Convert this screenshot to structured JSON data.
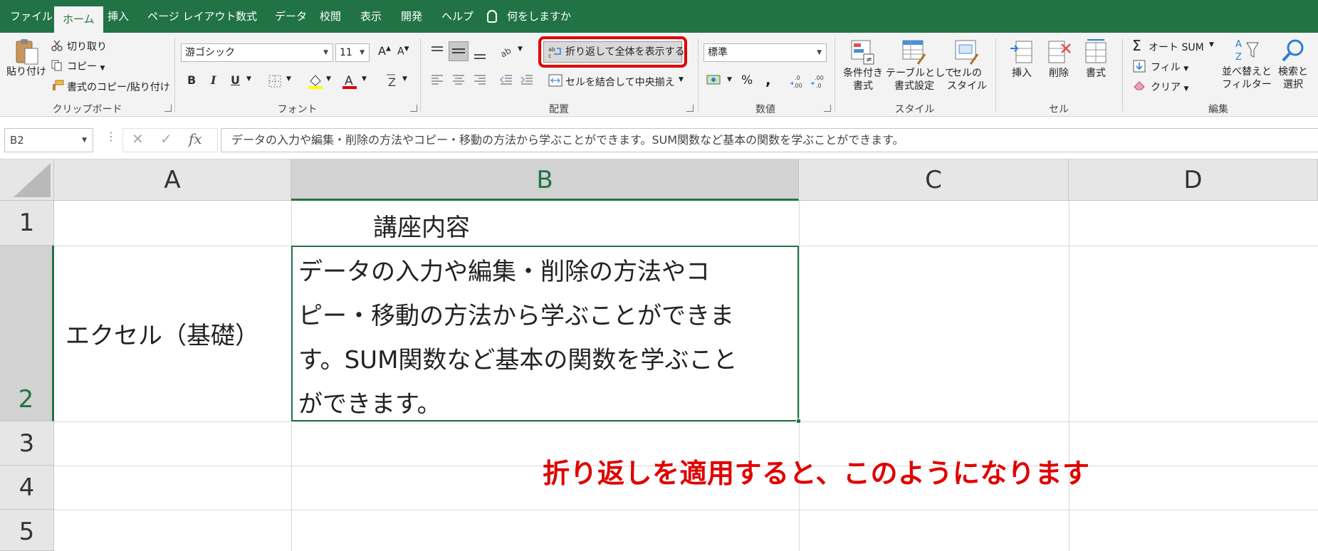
{
  "menu": {
    "tabs": [
      {
        "label": "ファイル",
        "active": false
      },
      {
        "label": "ホーム",
        "active": true
      },
      {
        "label": "挿入",
        "active": false
      },
      {
        "label": "ページ レイアウト",
        "active": false
      },
      {
        "label": "数式",
        "active": false
      },
      {
        "label": "データ",
        "active": false
      },
      {
        "label": "校閲",
        "active": false
      },
      {
        "label": "表示",
        "active": false
      },
      {
        "label": "開発",
        "active": false
      },
      {
        "label": "ヘルプ",
        "active": false
      }
    ],
    "tell_me": "何をしますか"
  },
  "ribbon": {
    "clipboard": {
      "paste": "貼り付け",
      "cut": "切り取り",
      "copy": "コピー",
      "format_painter": "書式のコピー/貼り付け",
      "group": "クリップボード"
    },
    "font": {
      "name": "游ゴシック",
      "size": "11",
      "bold": "B",
      "italic": "I",
      "underline": "U",
      "group": "フォント"
    },
    "alignment": {
      "wrap_text": "折り返して全体を表示する",
      "merge_center": "セルを結合して中央揃え",
      "group": "配置"
    },
    "number": {
      "format": "標準",
      "percent": "%",
      "comma": ",",
      "group": "数値"
    },
    "styles": {
      "conditional": "条件付き\n書式",
      "table": "テーブルとして\n書式設定",
      "cell_styles": "セルの\nスタイル",
      "group": "スタイル"
    },
    "cells": {
      "insert": "挿入",
      "delete": "削除",
      "format": "書式",
      "group": "セル"
    },
    "editing": {
      "autosum": "オート SUM",
      "fill": "フィル",
      "clear": "クリア",
      "sort": "並べ替えと\nフィルター",
      "find": "検索と\n選択",
      "group": "編集"
    }
  },
  "formula_bar": {
    "name_box": "B2",
    "formula": "データの入力や編集・削除の方法やコピー・移動の方法から学ぶことができます。SUM関数など基本の関数を学ぶことができます。"
  },
  "grid": {
    "columns": [
      "A",
      "B",
      "C",
      "D"
    ],
    "selected_column": "B",
    "rows": [
      "1",
      "2",
      "3",
      "4",
      "5"
    ],
    "selected_row": "2",
    "cells": {
      "b1": "講座内容",
      "a2": "エクセル（基礎）",
      "b2_lines": [
        "データの入力や編集・削除の方法やコ",
        "ピー・移動の方法から学ぶことができま",
        "す。SUM関数など基本の関数を学ぶこと",
        "ができます。"
      ]
    }
  },
  "annotation": {
    "note": "折り返しを適用すると、このようになります",
    "highlight_color": "#e00000"
  },
  "colors": {
    "excel_green": "#217346"
  }
}
